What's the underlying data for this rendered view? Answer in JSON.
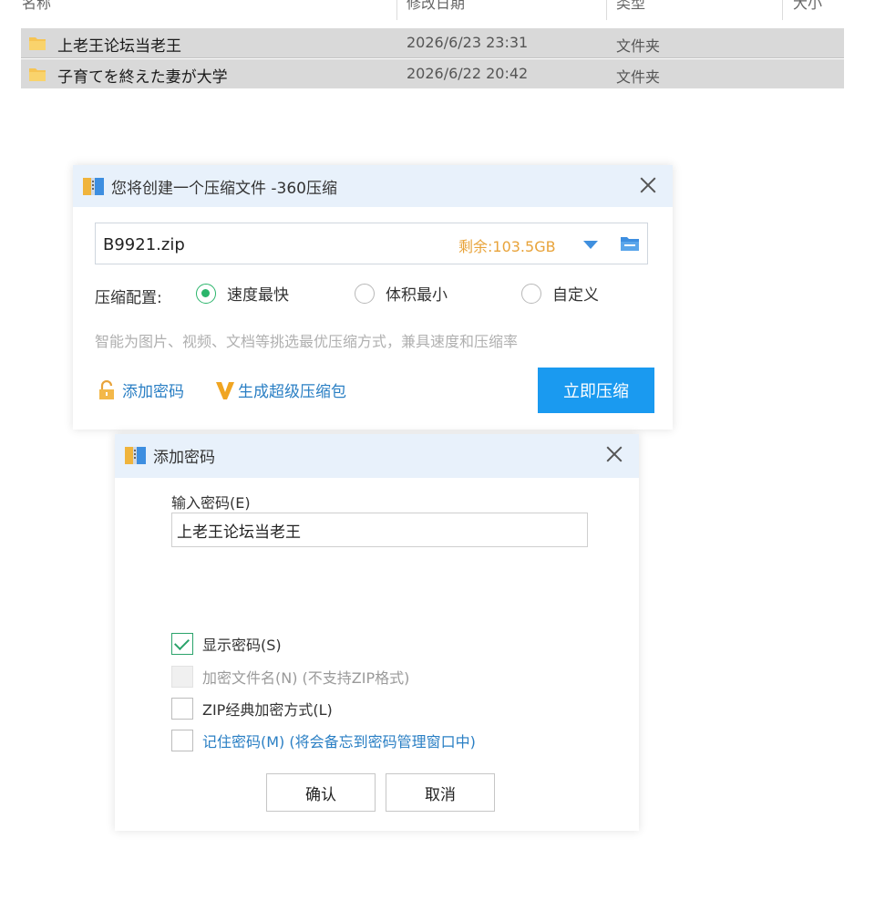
{
  "explorer": {
    "columns": [
      "名称",
      "修改日期",
      "类型",
      "大小"
    ],
    "rows": [
      {
        "name": "上老王论坛当老王",
        "date": "2026/6/23 23:31",
        "type": "文件夹"
      },
      {
        "name": "子育てを終えた妻が大学",
        "date": "2026/6/22 20:42",
        "type": "文件夹"
      }
    ]
  },
  "compress_dialog": {
    "title": "您将创建一个压缩文件 -360压缩",
    "filename": "B9921.zip",
    "space_left": "剩余:103.5GB",
    "config_label": "压缩配置:",
    "options": [
      "速度最快",
      "体积最小",
      "自定义"
    ],
    "selected_option": "速度最快",
    "hint": "智能为图片、视频、文档等挑选最优压缩方式，兼具速度和压缩率",
    "add_password": "添加密码",
    "super_package": "生成超级压缩包",
    "compress_now": "立即压缩"
  },
  "password_dialog": {
    "title": "添加密码",
    "input_label": "输入密码(E)",
    "password_value": "上老王论坛当老王",
    "options": [
      {
        "label": "显示密码(S)",
        "checked": true,
        "disabled": false
      },
      {
        "label": "加密文件名(N) (不支持ZIP格式)",
        "checked": false,
        "disabled": true
      },
      {
        "label": "ZIP经典加密方式(L)",
        "checked": false,
        "disabled": false
      },
      {
        "label": "记住密码(M) (将会备忘到密码管理窗口中)",
        "checked": false,
        "disabled": false
      }
    ],
    "ok": "确认",
    "cancel": "取消"
  },
  "colors": {
    "accent_blue": "#1a9af0",
    "radio_green": "#2bb56b",
    "space_orange": "#e8a33a",
    "link_blue": "#2a7fc4",
    "title_bar": "#e8f1fb",
    "selected_row": "#d9d9d9"
  },
  "icons": [
    "folder-icon",
    "archive-app-icon",
    "close-icon",
    "dropdown-arrow-icon",
    "browse-folder-icon",
    "lock-icon",
    "v-badge-icon"
  ]
}
